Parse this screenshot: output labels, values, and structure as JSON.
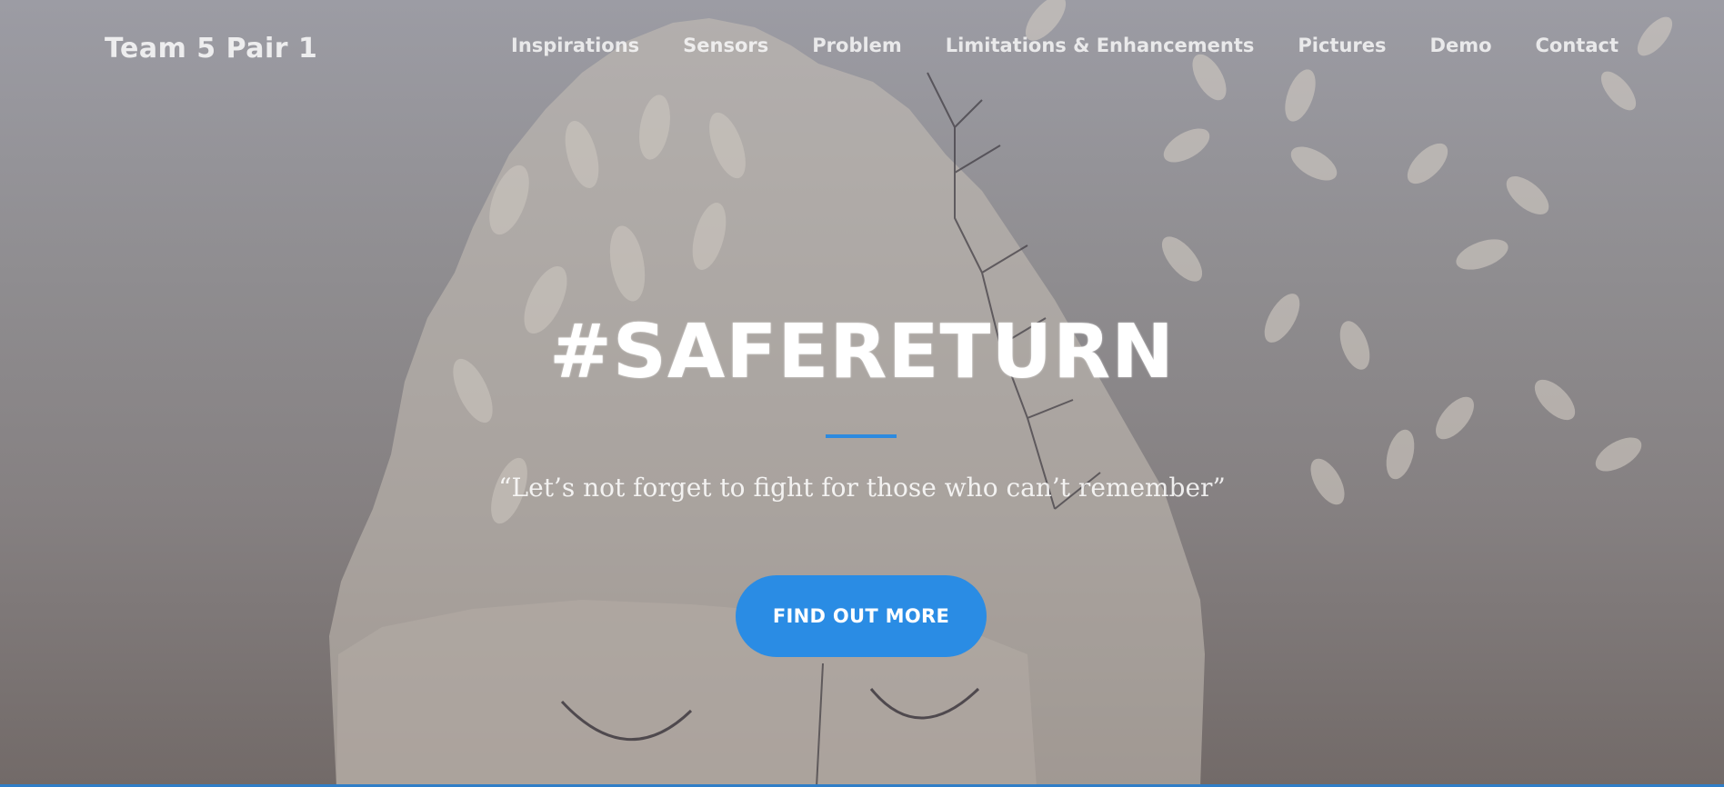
{
  "nav": {
    "brand": "Team 5 Pair 1",
    "links": [
      {
        "label": "Inspirations"
      },
      {
        "label": "Sensors"
      },
      {
        "label": "Problem"
      },
      {
        "label": "Limitations & Enhancements"
      },
      {
        "label": "Pictures"
      },
      {
        "label": "Demo"
      },
      {
        "label": "Contact"
      }
    ]
  },
  "hero": {
    "title": "#SAFERETURN",
    "tagline": "“Let’s not forget to fight for those who can’t remember”",
    "cta_label": "FIND OUT MORE"
  },
  "colors": {
    "accent": "#2a8ce4",
    "background_top": "#9c9ca4",
    "background_bottom": "#726a68",
    "illustration_fill": "#c2bbb2",
    "line_art": "#3e3a40"
  }
}
